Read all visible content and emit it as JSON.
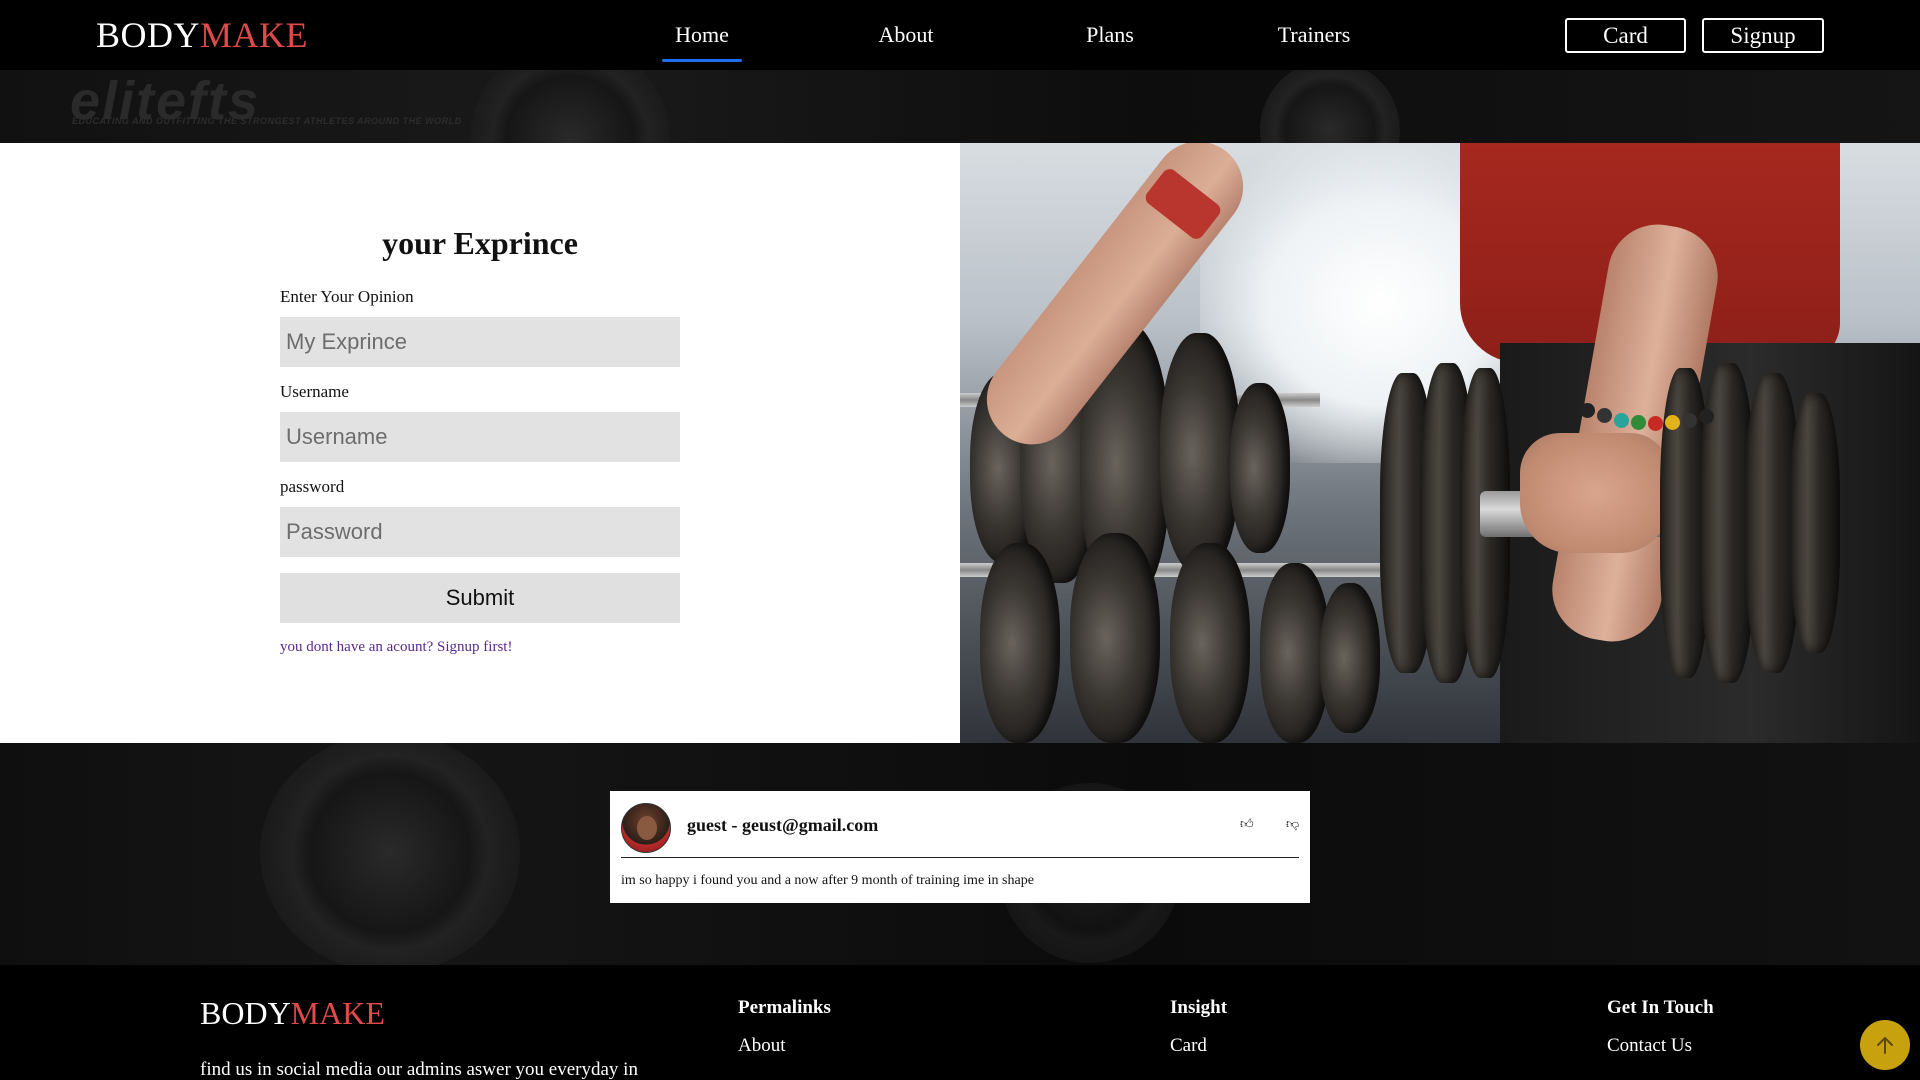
{
  "brand": {
    "name_part1": "BODY",
    "name_part2": "MAKE"
  },
  "nav": {
    "links": [
      {
        "label": "Home",
        "active": true
      },
      {
        "label": "About"
      },
      {
        "label": "Plans"
      },
      {
        "label": "Trainers"
      }
    ],
    "card_button": "Card",
    "signup_button": "Signup"
  },
  "hero_band": {
    "ghost_brand": "elitefts",
    "ghost_tagline": "EDUCATING AND OUTFITTING THE STRONGEST ATHLETES AROUND THE WORLD"
  },
  "form": {
    "title": "your Exprince",
    "opinion_label": "Enter Your Opinion",
    "opinion_placeholder": "My Exprince",
    "username_label": "Username",
    "username_placeholder": "Username",
    "password_label": "password",
    "password_placeholder": "Password",
    "submit_label": "Submit",
    "signup_prompt": "you dont have an acount? Signup first!"
  },
  "review": {
    "reviewer": "guest - geust@gmail.com",
    "text": "im so happy i found you and a now after 9 month of training ime in shape",
    "like_icon": "thumbs-up-icon",
    "dislike_icon": "thumbs-down-icon"
  },
  "footer": {
    "brand_part1": "BODY",
    "brand_part2": "MAKE",
    "about_text": "find us in social media our admins aswer you everyday in",
    "columns": [
      {
        "title": "Permalinks",
        "links": [
          "About"
        ]
      },
      {
        "title": "Insight",
        "links": [
          "Card"
        ]
      },
      {
        "title": "Get In Touch",
        "links": [
          "Contact Us"
        ]
      }
    ]
  },
  "colors": {
    "accent_red": "#e04a4a",
    "nav_active_underline": "#1e6ff0",
    "scroll_top_button": "#c8a20e",
    "link_purple": "#5b2a8c"
  }
}
